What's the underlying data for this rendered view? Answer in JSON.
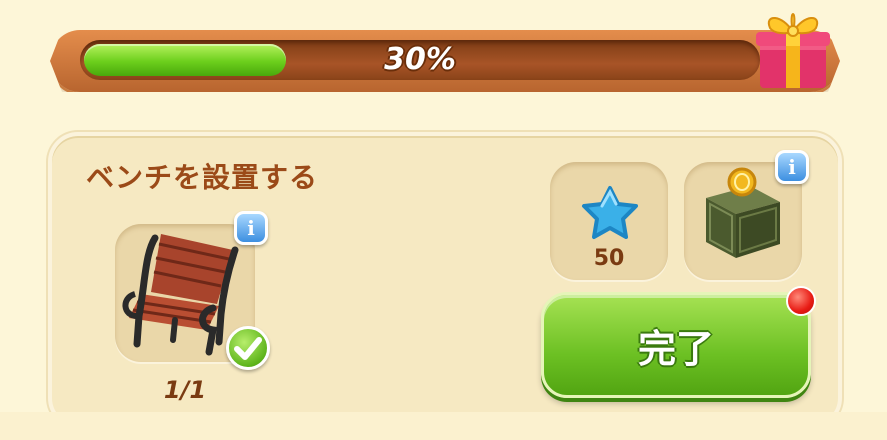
{
  "progress": {
    "label": "30%",
    "value": 0.3
  },
  "task": {
    "title": "ベンチを設置する",
    "item_count": "1/1",
    "item_status": "complete"
  },
  "rewards": [
    {
      "type": "star",
      "amount": "50"
    },
    {
      "type": "crate"
    }
  ],
  "actions": {
    "complete_label": "完了"
  },
  "icons": {
    "gift": "gift-box-icon",
    "bench": "bench-icon",
    "star": "blue-star-icon",
    "crate": "coin-crate-icon",
    "info": "info-icon",
    "check": "checkmark-icon"
  },
  "colors": {
    "accent_green": "#6cc023",
    "bar_brown": "#a85427",
    "title_brown": "#9b4a18",
    "info_blue": "#3d8fe0",
    "notify_red": "#e81b14"
  }
}
